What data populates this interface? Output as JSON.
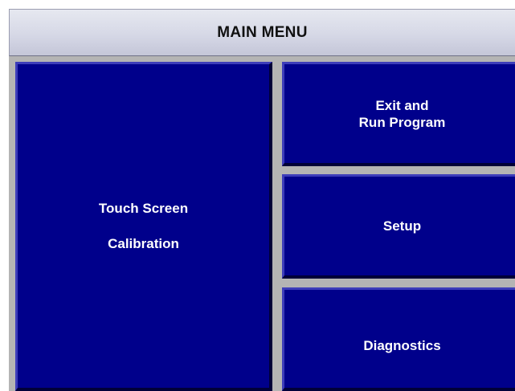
{
  "title": "MAIN MENU",
  "buttons": {
    "calibration": {
      "line1": "Touch Screen",
      "line2": "Calibration"
    },
    "exit": {
      "line1": "Exit and",
      "line2": "Run Program"
    },
    "setup": {
      "label": "Setup"
    },
    "diagnostics": {
      "label": "Diagnostics"
    }
  },
  "colors": {
    "button_bg": "#00008b",
    "frame": "#b4b4b4",
    "title_bg": "#d6d8e6"
  }
}
